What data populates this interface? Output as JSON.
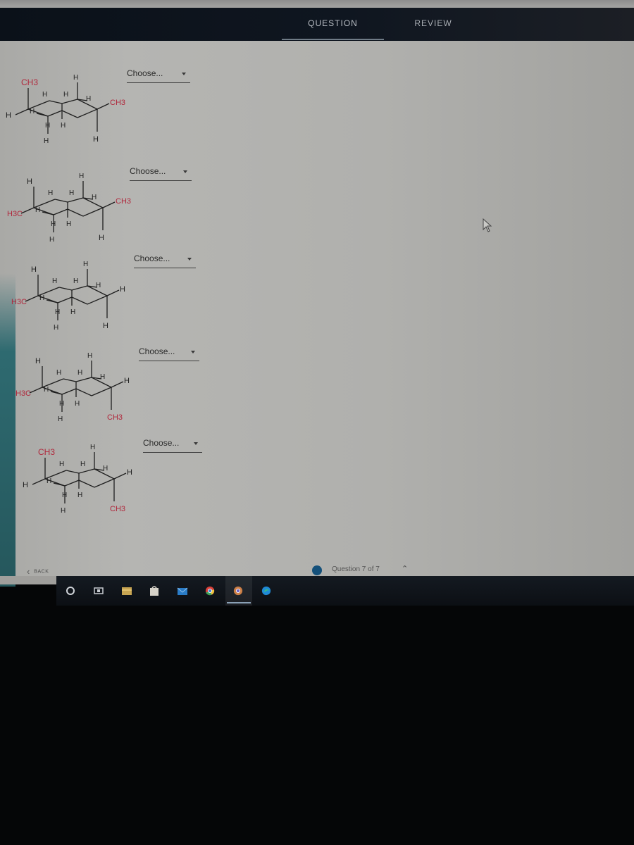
{
  "header": {
    "tabs": [
      {
        "label": "QUESTION",
        "active": true
      },
      {
        "label": "REVIEW",
        "active": false
      }
    ]
  },
  "questions": [
    {
      "dropdown": {
        "value": "Choose..."
      },
      "structure": {
        "top_left": "CH3",
        "right": "CH3",
        "left": "H",
        "bottom_right": "H",
        "substituent_color": "#b0283c"
      }
    },
    {
      "dropdown": {
        "value": "Choose..."
      },
      "structure": {
        "top_left": "H",
        "right": "CH3",
        "left": "H3C",
        "bottom_right": "H",
        "substituent_color": "#b0283c"
      }
    },
    {
      "dropdown": {
        "value": "Choose..."
      },
      "structure": {
        "top_left": "H",
        "right": "H",
        "left": "H3C",
        "bottom_right": "H",
        "substituent_color": "#b0283c"
      }
    },
    {
      "dropdown": {
        "value": "Choose..."
      },
      "structure": {
        "top_left": "H",
        "right": "H",
        "left": "H3C",
        "bottom_right": "CH3",
        "substituent_color": "#b0283c"
      }
    },
    {
      "dropdown": {
        "value": "Choose..."
      },
      "structure": {
        "top_left": "CH3",
        "right": "H",
        "left": "H",
        "bottom_right": "CH3",
        "substituent_color": "#b0283c"
      }
    }
  ],
  "atoms": {
    "H": "H"
  },
  "footer": {
    "back_label": "BACK",
    "back_icon": "chevron-left-icon",
    "progress_label": "Question 7 of 7",
    "progress_icon": "chevron-up-icon",
    "progress_color": "#14507a"
  },
  "taskbar": {
    "icons": [
      "cortana-icon",
      "task-view-icon",
      "file-explorer-icon",
      "store-icon",
      "mail-icon",
      "chrome-icon",
      "chrome-profile-icon",
      "edge-icon"
    ]
  }
}
